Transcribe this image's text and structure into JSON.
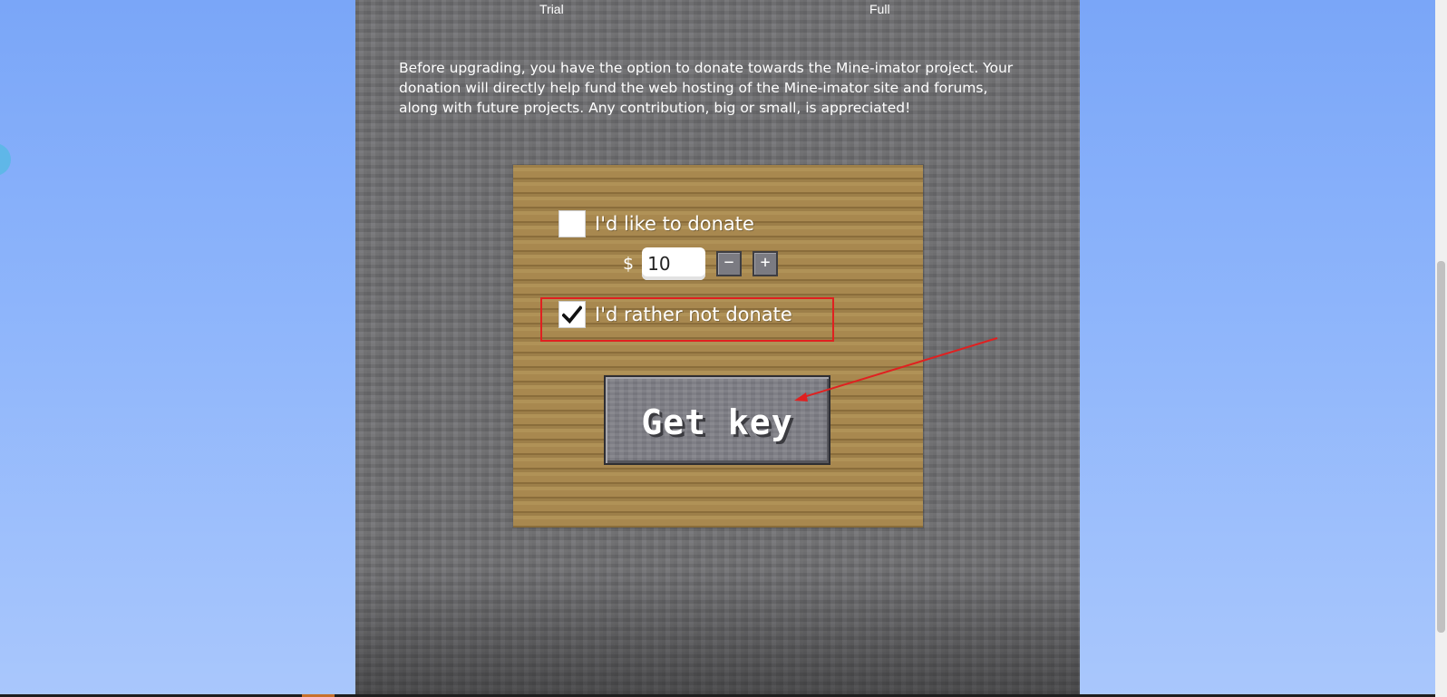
{
  "tiers": {
    "trial_label": "Trial",
    "full_label": "Full"
  },
  "intro_text": "Before upgrading, you have the option to donate towards the Mine-imator project. Your donation will directly help fund the web hosting of the Mine-imator site and forums, along with future projects. Any contribution, big or small, is appreciated!",
  "donation": {
    "donate_option_label": "I'd like to donate",
    "donate_checked": false,
    "currency_symbol": "$",
    "amount_value": "10",
    "decrement_label": "−",
    "increment_label": "+",
    "no_donate_option_label": "I'd rather not donate",
    "no_donate_checked": true
  },
  "actions": {
    "get_key_label": "Get key"
  },
  "colors": {
    "page_background": "#7aa6f8",
    "stone": "#6e6e71",
    "wood": "#a2834b",
    "highlight": "#e02020",
    "arrow": "#e02020"
  },
  "icons": {
    "checkmark": "checkmark-icon",
    "annotation_arrow": "arrow-icon"
  }
}
